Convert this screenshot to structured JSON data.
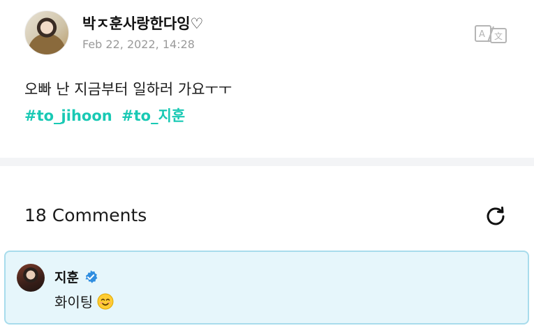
{
  "post": {
    "author": "박ㅈ훈사랑한다잉♡",
    "timestamp": "Feb 22, 2022, 14:28",
    "text": "오빠 난 지금부터 일하러 가요ㅜㅜ",
    "hashtags": [
      "#to_jihoon",
      "#to_지훈"
    ]
  },
  "comments": {
    "header": "18 Comments",
    "items": [
      {
        "author": "지훈",
        "verified": true,
        "text": "화이팅",
        "emoji": "smiling-face-emoji"
      }
    ]
  },
  "colors": {
    "hashtag": "#19c9b4",
    "verified_badge": "#2f8ee0",
    "comment_bg": "#e6f6fb",
    "comment_border": "#a8dcec"
  },
  "icons": {
    "translate": "translate-icon",
    "refresh": "refresh-icon",
    "verified": "verified-badge-icon"
  }
}
